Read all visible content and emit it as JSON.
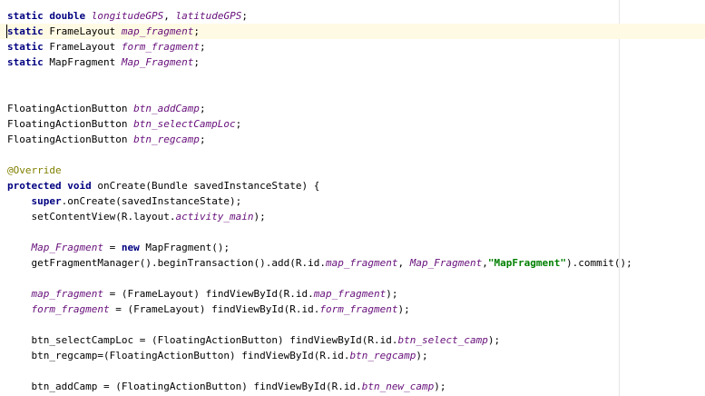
{
  "colors": {
    "keyword": "#000080",
    "field": "#660e7a",
    "string": "#008000",
    "annotation": "#808000",
    "current_line_bg": "#fffae3"
  },
  "code": {
    "l1": {
      "kw1": "static",
      "kw2": "double",
      "f1": "longitudeGPS",
      "p1": ", ",
      "f2": "latitudeGPS",
      "p2": ";"
    },
    "l2": {
      "kw": "static",
      "type": " FrameLayout ",
      "f": "map_fragment",
      "p": ";"
    },
    "l3": {
      "kw": "static",
      "type": " FrameLayout ",
      "f": "form_fragment",
      "p": ";"
    },
    "l4": {
      "kw": "static",
      "type": " MapFragment ",
      "f": "Map_Fragment",
      "p": ";"
    },
    "l7": {
      "type": "FloatingActionButton ",
      "f": "btn_addCamp",
      "p": ";"
    },
    "l8": {
      "type": "FloatingActionButton ",
      "f": "btn_selectCampLoc",
      "p": ";"
    },
    "l9": {
      "type": "FloatingActionButton ",
      "f": "btn_regcamp",
      "p": ";"
    },
    "l11": {
      "anno": "@Override"
    },
    "l12": {
      "kw1": "protected",
      "kw2": "void",
      "rest": " onCreate(Bundle savedInstanceState) {"
    },
    "l13": {
      "kw": "super",
      "rest": ".onCreate(savedInstanceState);"
    },
    "l14": {
      "a": "setContentView(R.layout.",
      "f": "activity_main",
      "b": ");"
    },
    "l16": {
      "f": "Map_Fragment",
      "a": " = ",
      "kw": "new",
      "b": " MapFragment();"
    },
    "l17": {
      "a": "getFragmentManager().beginTransaction().add(R.id.",
      "f1": "map_fragment",
      "b": ", ",
      "f2": "Map_Fragment",
      "c": ",",
      "str": "\"MapFragment\"",
      "d": ").commit();"
    },
    "l19": {
      "f1": "map_fragment",
      "a": " = (FrameLayout) findViewById(R.id.",
      "f2": "map_fragment",
      "b": ");"
    },
    "l20": {
      "f1": "form_fragment",
      "a": " = (FrameLayout) findViewById(R.id.",
      "f2": "form_fragment",
      "b": ");"
    },
    "l22": {
      "f1": "btn_selectCampLoc",
      "a": " = (FloatingActionButton) findViewById(R.id.",
      "f2": "btn_select_camp",
      "b": ");"
    },
    "l23": {
      "f1": "btn_regcamp",
      "a": "=(FloatingActionButton) findViewById(R.id.",
      "f2": "btn_regcamp",
      "b": ");"
    },
    "l25": {
      "f1": "btn_addCamp",
      "a": " = (FloatingActionButton) findViewById(R.id.",
      "f2": "btn_new_camp",
      "b": ");"
    }
  }
}
